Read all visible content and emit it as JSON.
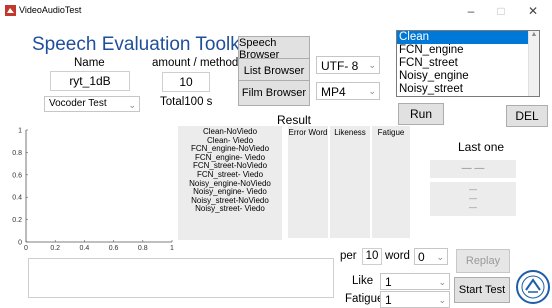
{
  "window": {
    "title": "VideoAudioTest",
    "minimize_glyph": "–",
    "maximize_glyph": "□",
    "close_glyph": "✕"
  },
  "app": {
    "title": "Speech Evaluation Toolkit"
  },
  "form": {
    "name_label": "Name",
    "name_value": "ryt_1dB",
    "amount_label": "amount / method",
    "amount_value": "10",
    "total_label": "Total100 s",
    "vocoder_select": "Vocoder Test"
  },
  "buttons": {
    "speech_browser": "Speech Browser",
    "list_browser": "List Browser",
    "film_browser": "Film Browser",
    "run": "Run",
    "del": "DEL",
    "replay": "Replay",
    "start_test": "Start Test"
  },
  "selects": {
    "encoding": "UTF- 8",
    "format": "MP4"
  },
  "condition_list": {
    "items": [
      "Clean",
      "FCN_engine",
      "FCN_street",
      "Noisy_engine",
      "Noisy_street"
    ],
    "selected_index": 0
  },
  "result": {
    "heading": "Result",
    "headers": [
      "Error Word",
      "Likeness",
      "Fatigue"
    ],
    "conditions": [
      "Clean-NoViedo",
      "Clean-  Viedo",
      "FCN_engine-NoViedo",
      "FCN_engine-  Viedo",
      "FCN_street-NoViedo",
      "FCN_street-  Viedo",
      "Noisy_engine-NoViedo",
      "Noisy_engine-  Viedo",
      "Noisy_street-NoViedo",
      "Noisy_street-  Viedo"
    ]
  },
  "last_one": {
    "label": "Last one",
    "value1": "— —",
    "value2": [
      "—",
      "—",
      "—"
    ]
  },
  "chart_data": {
    "type": "line",
    "title": "",
    "xlabel": "",
    "ylabel": "",
    "xlim": [
      0,
      1
    ],
    "ylim": [
      0,
      1
    ],
    "xticks": [
      "0",
      "0.2",
      "0.4",
      "0.6",
      "0.8",
      "1"
    ],
    "yticks": [
      "0",
      "0.2",
      "0.4",
      "0.6",
      "0.8",
      "1"
    ],
    "series": []
  },
  "controls": {
    "per_label": "per",
    "per_value": "10",
    "word_label": "word",
    "word_value": "0",
    "like_label": "Like",
    "like_value": "1",
    "fatigue_label": "Fatigue",
    "fatigue_value": "1"
  },
  "colors": {
    "title_blue": "#1f4f9a",
    "selection_blue": "#0078d7",
    "panel_gray": "#ececec"
  }
}
